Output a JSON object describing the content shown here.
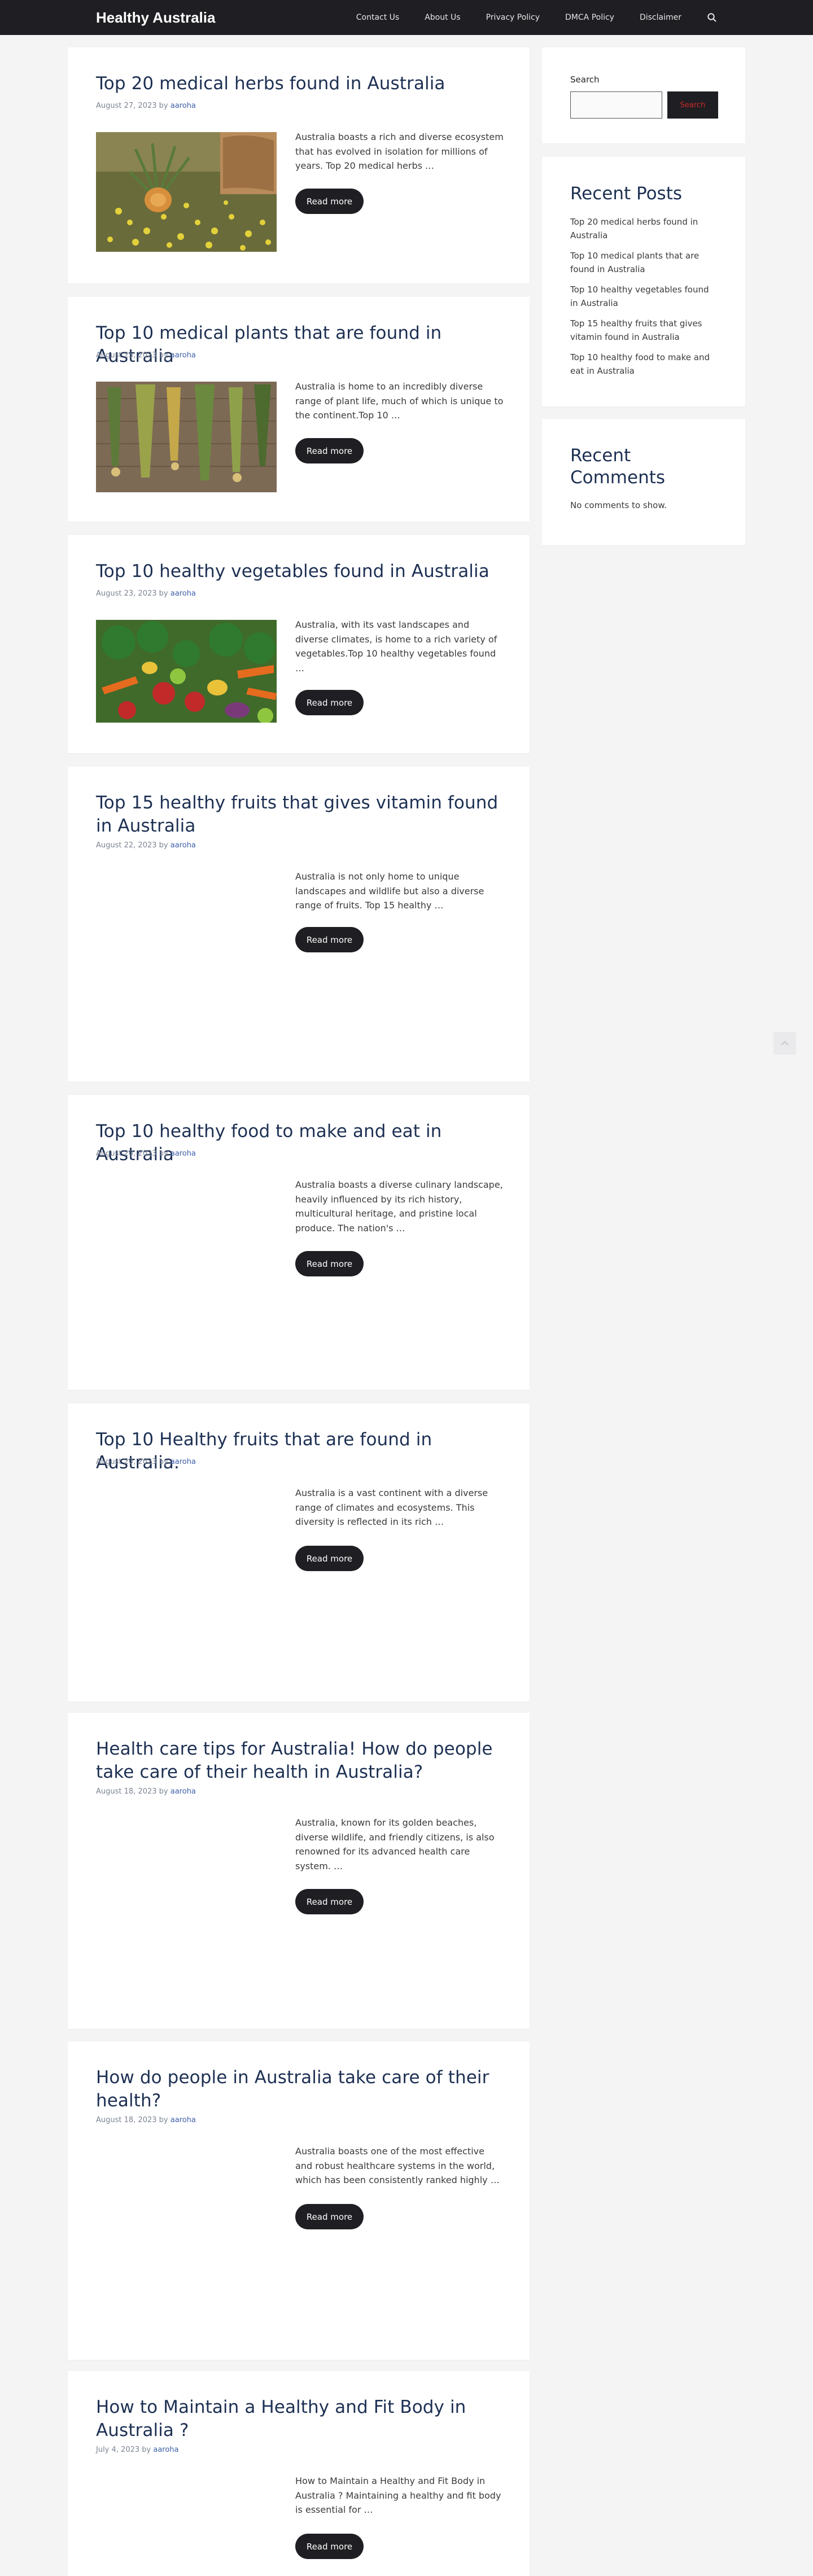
{
  "site": {
    "brand": "Healthy Australia",
    "nav": [
      "Contact Us",
      "About Us",
      "Privacy Policy",
      "DMCA Policy",
      "Disclaimer"
    ],
    "search_icon": "search-icon"
  },
  "posts": [
    {
      "title": "Top 20 medical herbs found in Australia",
      "date": "August 27, 2023",
      "author": "aaroha",
      "excerpt": "Australia boasts a rich and diverse ecosystem that has evolved in isolation for millions of years. Top 20 medical herbs …",
      "read_more": "Read more"
    },
    {
      "title": "Top 10 medical plants that are found in Australia",
      "date": "August 25, 2023",
      "author": "aaroha",
      "excerpt": "Australia is home to an incredibly diverse range of plant life, much of which is unique to the continent.Top 10 …",
      "read_more": "Read more"
    },
    {
      "title": "Top 10 healthy vegetables found in Australia",
      "date": "August 23, 2023",
      "author": "aaroha",
      "excerpt": "Australia, with its vast landscapes and diverse climates, is home to a rich variety of vegetables.Top 10 healthy vegetables found …",
      "read_more": "Read more"
    },
    {
      "title": "Top 15 healthy fruits that gives vitamin found in Australia",
      "date": "August 22, 2023",
      "author": "aaroha",
      "excerpt": "Australia is not only home to unique landscapes and wildlife but also a diverse range of fruits. Top 15 healthy …",
      "read_more": "Read more"
    },
    {
      "title": "Top 10 healthy food to make and eat in Australia",
      "date": "August 20, 2023",
      "author": "aaroha",
      "excerpt": "Australia boasts a diverse culinary landscape, heavily influenced by its rich history, multicultural heritage, and pristine local produce. The nation's …",
      "read_more": "Read more"
    },
    {
      "title": "Top 10 Healthy fruits that are found in Australia.",
      "date": "August 20, 2023",
      "author": "aaroha",
      "excerpt": "Australia is a vast continent with a diverse range of climates and ecosystems. This diversity is reflected in its rich …",
      "read_more": "Read more"
    },
    {
      "title": "Health care tips for Australia! How do people take care of their health in Australia?",
      "date": "August 18, 2023",
      "author": "aaroha",
      "excerpt": "Australia, known for its golden beaches, diverse wildlife, and friendly citizens, is also renowned for its advanced health care system. …",
      "read_more": "Read more"
    },
    {
      "title": "How do people in Australia take care of their health?",
      "date": "August 18, 2023",
      "author": "aaroha",
      "excerpt": "Australia boasts one of the most effective and robust healthcare systems in the world, which has been consistently ranked highly …",
      "read_more": "Read more"
    },
    {
      "title": "How to Maintain a Healthy and Fit Body in Australia ?",
      "date": "July 4, 2023",
      "author": "aaroha",
      "excerpt": "How to Maintain a Healthy and Fit Body in Australia ? Maintaining a healthy and fit body is essential for …",
      "read_more": "Read more"
    }
  ],
  "sidebar": {
    "search_label": "Search",
    "search_button": "Search",
    "recent_posts_title": "Recent Posts",
    "recent_posts": [
      "Top 20 medical herbs found in Australia",
      "Top 10 medical plants that are found in Australia",
      "Top 10 healthy vegetables found in Australia",
      "Top 15 healthy fruits that gives vitamin found in Australia",
      "Top 10 healthy food to make and eat in Australia"
    ],
    "recent_comments_title": "Recent Comments",
    "no_comments": "No comments to show."
  }
}
